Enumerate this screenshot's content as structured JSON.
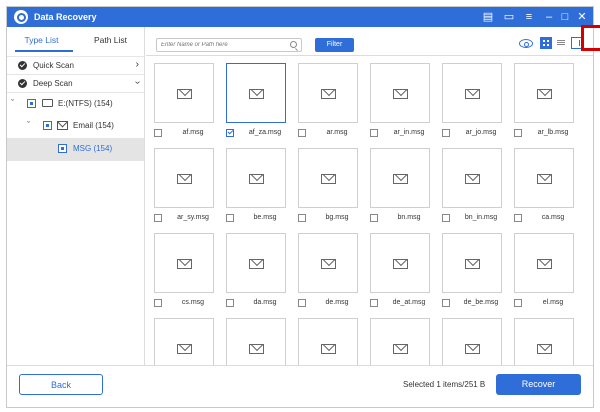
{
  "window": {
    "title": "Data Recovery"
  },
  "titlebar_icons": [
    "feedback-icon",
    "save-icon",
    "menu-icon",
    "minimize-icon",
    "maximize-icon",
    "close-icon"
  ],
  "sidebar": {
    "tabs": [
      {
        "label": "Type List",
        "active": true
      },
      {
        "label": "Path List",
        "active": false
      }
    ],
    "scans": [
      {
        "label": "Quick Scan"
      },
      {
        "label": "Deep Scan"
      }
    ],
    "tree": [
      {
        "label": "E:(NTFS) (154)"
      },
      {
        "label": "Email (154)"
      },
      {
        "label": "MSG (154)"
      }
    ]
  },
  "toolbar": {
    "search_placeholder": "Enter Name or Path here",
    "filter_label": "Filter"
  },
  "files": [
    {
      "name": "af.msg",
      "checked": false,
      "selected": false
    },
    {
      "name": "af_za.msg",
      "checked": true,
      "selected": true
    },
    {
      "name": "ar.msg",
      "checked": false,
      "selected": false
    },
    {
      "name": "ar_in.msg",
      "checked": false,
      "selected": false
    },
    {
      "name": "ar_jo.msg",
      "checked": false,
      "selected": false
    },
    {
      "name": "ar_lb.msg",
      "checked": false,
      "selected": false
    },
    {
      "name": "ar_sy.msg",
      "checked": false,
      "selected": false
    },
    {
      "name": "be.msg",
      "checked": false,
      "selected": false
    },
    {
      "name": "bg.msg",
      "checked": false,
      "selected": false
    },
    {
      "name": "bn.msg",
      "checked": false,
      "selected": false
    },
    {
      "name": "bn_in.msg",
      "checked": false,
      "selected": false
    },
    {
      "name": "ca.msg",
      "checked": false,
      "selected": false
    },
    {
      "name": "cs.msg",
      "checked": false,
      "selected": false
    },
    {
      "name": "da.msg",
      "checked": false,
      "selected": false
    },
    {
      "name": "de.msg",
      "checked": false,
      "selected": false
    },
    {
      "name": "de_at.msg",
      "checked": false,
      "selected": false
    },
    {
      "name": "de_be.msg",
      "checked": false,
      "selected": false
    },
    {
      "name": "el.msg",
      "checked": false,
      "selected": false
    },
    {
      "name": "",
      "checked": false,
      "selected": false
    },
    {
      "name": "",
      "checked": false,
      "selected": false
    },
    {
      "name": "",
      "checked": false,
      "selected": false
    },
    {
      "name": "",
      "checked": false,
      "selected": false
    },
    {
      "name": "",
      "checked": false,
      "selected": false
    },
    {
      "name": "",
      "checked": false,
      "selected": false
    }
  ],
  "footer": {
    "back_label": "Back",
    "status_text": "Selected 1 items/251  B",
    "recover_label": "Recover"
  },
  "colors": {
    "accent": "#2f6ed8",
    "highlight": "#d40000"
  }
}
